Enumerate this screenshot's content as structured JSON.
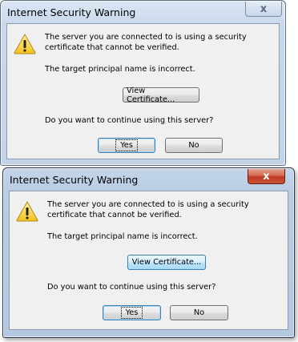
{
  "dialogs": [
    {
      "title": "Internet Security Warning",
      "close_label": "x",
      "message": "The server you are connected to is using a security certificate that cannot be verified.",
      "detail": "The target principal name is incorrect.",
      "view_certificate_label": "View Certificate...",
      "question": "Do you want to continue using this server?",
      "yes_label": "Yes",
      "no_label": "No",
      "icon": "warning-icon"
    },
    {
      "title": "Internet Security Warning",
      "close_label": "x",
      "message": "The server you are connected to is using a security certificate that cannot be verified.",
      "detail": "The target principal name is incorrect.",
      "view_certificate_label": "View Certificate...",
      "question": "Do you want to continue using this server?",
      "yes_label": "Yes",
      "no_label": "No",
      "icon": "warning-icon"
    }
  ],
  "colors": {
    "close_active": "#c8553a",
    "focus_border": "#3c7fb1",
    "panel": "#f0f0f0"
  }
}
